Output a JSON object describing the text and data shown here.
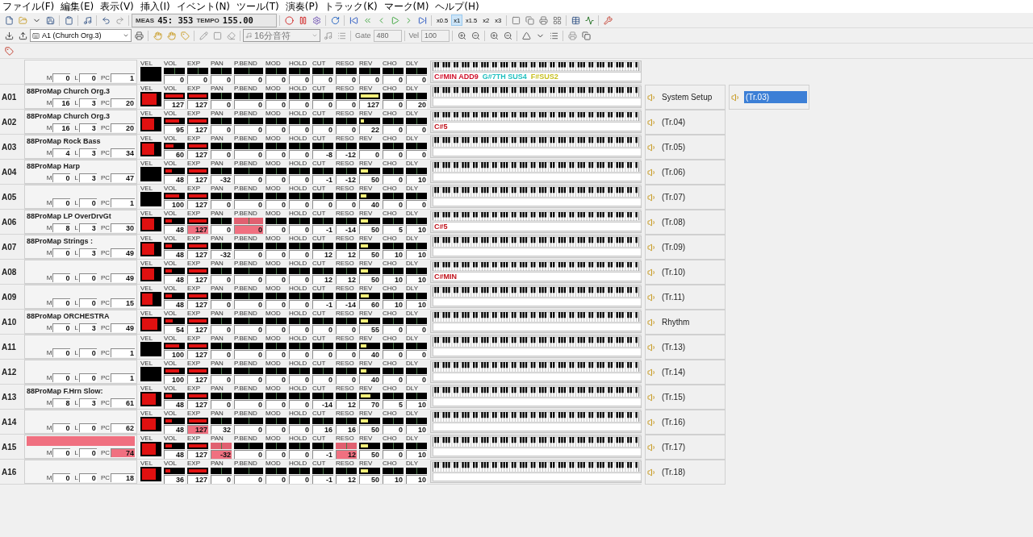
{
  "menu": [
    "ファイル(F)",
    "編集(E)",
    "表示(V)",
    "挿入(I)",
    "イベント(N)",
    "ツール(T)",
    "演奏(P)",
    "トラック(K)",
    "マーク(M)",
    "ヘルプ(H)"
  ],
  "transport": {
    "meas_label": "MEAS",
    "meas": "45: 353",
    "tempo_label": "TEMPO",
    "tempo": "155.00"
  },
  "speeds": [
    {
      "label": "x0.5",
      "selected": false
    },
    {
      "label": "x1",
      "selected": true
    },
    {
      "label": "x1.5",
      "selected": false
    },
    {
      "label": "x2",
      "selected": false
    },
    {
      "label": "x3",
      "selected": false
    }
  ],
  "port_select": {
    "value": "A1  (Church Org.3)"
  },
  "note_select": {
    "value": "16分音符",
    "disabled": true
  },
  "gate": {
    "label": "Gate",
    "value": "480",
    "disabled": true
  },
  "vel": {
    "label": "Vel",
    "value": "100",
    "disabled": true
  },
  "master": {
    "bank": [
      {
        "label": "M",
        "value": "0"
      },
      {
        "label": "L",
        "value": "0"
      },
      {
        "label": "PC",
        "value": "1"
      }
    ],
    "chord": [
      {
        "text": "C#MIN ADD9",
        "color": "#d0102a"
      },
      {
        "text": "G#7TH SUS4",
        "color": "#20c0c0"
      },
      {
        "text": "F#SUS2",
        "color": "#c8c020"
      }
    ],
    "controls": [
      {
        "kind": "vel",
        "label": "VEL"
      },
      {
        "kind": "bar",
        "label": "VOL",
        "value": "0"
      },
      {
        "kind": "bar",
        "label": "EXP",
        "value": "0"
      },
      {
        "kind": "bar",
        "label": "PAN",
        "value": "0"
      },
      {
        "kind": "bar",
        "label": "P.BEND",
        "value": "0"
      },
      {
        "kind": "bar",
        "label": "MOD",
        "value": "0"
      },
      {
        "kind": "bar",
        "label": "HOLD",
        "value": "0"
      },
      {
        "kind": "bar",
        "label": "CUT",
        "value": "0"
      },
      {
        "kind": "bar",
        "label": "RESO",
        "value": "0"
      },
      {
        "kind": "bar",
        "label": "REV",
        "value": "0"
      },
      {
        "kind": "bar",
        "label": "CHO",
        "value": "0"
      },
      {
        "kind": "bar",
        "label": "DLY",
        "value": "0"
      }
    ]
  },
  "channels": [
    {
      "port": "A01",
      "name": "88ProMap Church Org.3",
      "bank": [
        {
          "label": "M",
          "value": "16"
        },
        {
          "label": "L",
          "value": "3"
        },
        {
          "label": "PC",
          "value": "20"
        }
      ],
      "controls": [
        {
          "kind": "vel",
          "label": "VEL",
          "level": 0.8
        },
        {
          "kind": "fill",
          "label": "VOL",
          "value": "127",
          "level": 1
        },
        {
          "kind": "fill",
          "label": "EXP",
          "value": "127",
          "level": 1
        },
        {
          "kind": "bar",
          "label": "PAN",
          "value": "0"
        },
        {
          "kind": "bar",
          "label": "P.BEND",
          "value": "0"
        },
        {
          "kind": "bar",
          "label": "MOD",
          "value": "0"
        },
        {
          "kind": "bar",
          "label": "HOLD",
          "value": "0"
        },
        {
          "kind": "bar",
          "label": "CUT",
          "value": "0"
        },
        {
          "kind": "bar",
          "label": "RESO",
          "value": "0"
        },
        {
          "kind": "send",
          "label": "REV",
          "value": "127",
          "level": 1
        },
        {
          "kind": "bar",
          "label": "CHO",
          "value": "0"
        },
        {
          "kind": "bar",
          "label": "DLY",
          "value": "20"
        }
      ]
    },
    {
      "port": "A02",
      "name": "88ProMap Church Org.3",
      "bank": [
        {
          "label": "M",
          "value": "16"
        },
        {
          "label": "L",
          "value": "3"
        },
        {
          "label": "PC",
          "value": "20"
        }
      ],
      "chord": [
        {
          "text": "C#5",
          "color": "#c0101a"
        }
      ],
      "controls": [
        {
          "kind": "vel",
          "label": "VEL",
          "level": 0.7
        },
        {
          "kind": "fill",
          "label": "VOL",
          "value": "95",
          "level": 0.75
        },
        {
          "kind": "fill",
          "label": "EXP",
          "value": "127",
          "level": 1
        },
        {
          "kind": "bar",
          "label": "PAN",
          "value": "0"
        },
        {
          "kind": "bar",
          "label": "P.BEND",
          "value": "0"
        },
        {
          "kind": "bar",
          "label": "MOD",
          "value": "0"
        },
        {
          "kind": "bar",
          "label": "HOLD",
          "value": "0"
        },
        {
          "kind": "bar",
          "label": "CUT",
          "value": "0"
        },
        {
          "kind": "bar",
          "label": "RESO",
          "value": "0"
        },
        {
          "kind": "send",
          "label": "REV",
          "value": "22",
          "level": 0.17
        },
        {
          "kind": "bar",
          "label": "CHO",
          "value": "0"
        },
        {
          "kind": "bar",
          "label": "DLY",
          "value": "0"
        }
      ]
    },
    {
      "port": "A03",
      "name": "88ProMap Rock Bass",
      "bank": [
        {
          "label": "M",
          "value": "4"
        },
        {
          "label": "L",
          "value": "3"
        },
        {
          "label": "PC",
          "value": "34"
        }
      ],
      "controls": [
        {
          "kind": "vel",
          "label": "VEL",
          "level": 0.7
        },
        {
          "kind": "fill",
          "label": "VOL",
          "value": "60",
          "level": 0.47
        },
        {
          "kind": "fill",
          "label": "EXP",
          "value": "127",
          "level": 1
        },
        {
          "kind": "bar",
          "label": "PAN",
          "value": "0"
        },
        {
          "kind": "bar",
          "label": "P.BEND",
          "value": "0"
        },
        {
          "kind": "bar",
          "label": "MOD",
          "value": "0"
        },
        {
          "kind": "bar",
          "label": "HOLD",
          "value": "0"
        },
        {
          "kind": "bar",
          "label": "CUT",
          "value": "-8"
        },
        {
          "kind": "bar",
          "label": "RESO",
          "value": "-12"
        },
        {
          "kind": "send",
          "label": "REV",
          "value": "0"
        },
        {
          "kind": "bar",
          "label": "CHO",
          "value": "0"
        },
        {
          "kind": "bar",
          "label": "DLY",
          "value": "0"
        }
      ]
    },
    {
      "port": "A04",
      "name": "88ProMap Harp",
      "bank": [
        {
          "label": "M",
          "value": "0"
        },
        {
          "label": "L",
          "value": "3"
        },
        {
          "label": "PC",
          "value": "47"
        }
      ],
      "controls": [
        {
          "kind": "vel",
          "label": "VEL"
        },
        {
          "kind": "fill",
          "label": "VOL",
          "value": "48",
          "level": 0.38
        },
        {
          "kind": "fill",
          "label": "EXP",
          "value": "127",
          "level": 1
        },
        {
          "kind": "bar",
          "label": "PAN",
          "value": "-32"
        },
        {
          "kind": "bar",
          "label": "P.BEND",
          "value": "0"
        },
        {
          "kind": "bar",
          "label": "MOD",
          "value": "0"
        },
        {
          "kind": "bar",
          "label": "HOLD",
          "value": "0"
        },
        {
          "kind": "bar",
          "label": "CUT",
          "value": "-1"
        },
        {
          "kind": "bar",
          "label": "RESO",
          "value": "-12"
        },
        {
          "kind": "send",
          "label": "REV",
          "value": "50",
          "level": 0.39
        },
        {
          "kind": "bar",
          "label": "CHO",
          "value": "0"
        },
        {
          "kind": "bar",
          "label": "DLY",
          "value": "10"
        }
      ]
    },
    {
      "port": "A05",
      "bank": [
        {
          "label": "M",
          "value": "0"
        },
        {
          "label": "L",
          "value": "0"
        },
        {
          "label": "PC",
          "value": "1"
        }
      ],
      "controls": [
        {
          "kind": "vel",
          "label": "VEL"
        },
        {
          "kind": "fill",
          "label": "VOL",
          "value": "100",
          "level": 0.79
        },
        {
          "kind": "fill",
          "label": "EXP",
          "value": "127",
          "level": 1
        },
        {
          "kind": "bar",
          "label": "PAN",
          "value": "0"
        },
        {
          "kind": "bar",
          "label": "P.BEND",
          "value": "0"
        },
        {
          "kind": "bar",
          "label": "MOD",
          "value": "0"
        },
        {
          "kind": "bar",
          "label": "HOLD",
          "value": "0"
        },
        {
          "kind": "bar",
          "label": "CUT",
          "value": "0"
        },
        {
          "kind": "bar",
          "label": "RESO",
          "value": "0"
        },
        {
          "kind": "send",
          "label": "REV",
          "value": "40",
          "level": 0.31
        },
        {
          "kind": "bar",
          "label": "CHO",
          "value": "0"
        },
        {
          "kind": "bar",
          "label": "DLY",
          "value": "0"
        }
      ]
    },
    {
      "port": "A06",
      "name": "88ProMap LP OverDrvGt",
      "bank": [
        {
          "label": "M",
          "value": "8"
        },
        {
          "label": "L",
          "value": "3"
        },
        {
          "label": "PC",
          "value": "30"
        }
      ],
      "chord": [
        {
          "text": "C#5",
          "color": "#c0101a"
        }
      ],
      "controls": [
        {
          "kind": "vel",
          "label": "VEL",
          "level": 0.7
        },
        {
          "kind": "fill",
          "label": "VOL",
          "value": "48",
          "level": 0.38
        },
        {
          "kind": "fill",
          "label": "EXP",
          "value": "127",
          "level": 1,
          "highlighted": true
        },
        {
          "kind": "bar",
          "label": "PAN",
          "value": "0"
        },
        {
          "kind": "bar",
          "label": "P.BEND",
          "value": "0",
          "highlighted": true
        },
        {
          "kind": "bar",
          "label": "MOD",
          "value": "0"
        },
        {
          "kind": "bar",
          "label": "HOLD",
          "value": "0"
        },
        {
          "kind": "bar",
          "label": "CUT",
          "value": "-1"
        },
        {
          "kind": "bar",
          "label": "RESO",
          "value": "-14"
        },
        {
          "kind": "send",
          "label": "REV",
          "value": "50",
          "level": 0.39
        },
        {
          "kind": "bar",
          "label": "CHO",
          "value": "5"
        },
        {
          "kind": "bar",
          "label": "DLY",
          "value": "10"
        }
      ]
    },
    {
      "port": "A07",
      "name": "88ProMap Strings  :",
      "bank": [
        {
          "label": "M",
          "value": "0"
        },
        {
          "label": "L",
          "value": "3"
        },
        {
          "label": "PC",
          "value": "49"
        }
      ],
      "controls": [
        {
          "kind": "vel",
          "label": "VEL",
          "level": 0.7
        },
        {
          "kind": "fill",
          "label": "VOL",
          "value": "48",
          "level": 0.38
        },
        {
          "kind": "fill",
          "label": "EXP",
          "value": "127",
          "level": 1
        },
        {
          "kind": "bar",
          "label": "PAN",
          "value": "-32"
        },
        {
          "kind": "bar",
          "label": "P.BEND",
          "value": "0"
        },
        {
          "kind": "bar",
          "label": "MOD",
          "value": "0"
        },
        {
          "kind": "bar",
          "label": "HOLD",
          "value": "0"
        },
        {
          "kind": "bar",
          "label": "CUT",
          "value": "12"
        },
        {
          "kind": "bar",
          "label": "RESO",
          "value": "12"
        },
        {
          "kind": "send",
          "label": "REV",
          "value": "50",
          "level": 0.39
        },
        {
          "kind": "bar",
          "label": "CHO",
          "value": "10"
        },
        {
          "kind": "bar",
          "label": "DLY",
          "value": "10"
        }
      ]
    },
    {
      "port": "A08",
      "bank": [
        {
          "label": "M",
          "value": "0"
        },
        {
          "label": "L",
          "value": "0"
        },
        {
          "label": "PC",
          "value": "49"
        }
      ],
      "chord": [
        {
          "text": "C#MIN",
          "color": "#c0101a"
        }
      ],
      "controls": [
        {
          "kind": "vel",
          "label": "VEL",
          "level": 0.7
        },
        {
          "kind": "fill",
          "label": "VOL",
          "value": "48",
          "level": 0.38
        },
        {
          "kind": "fill",
          "label": "EXP",
          "value": "127",
          "level": 1
        },
        {
          "kind": "bar",
          "label": "PAN",
          "value": "0"
        },
        {
          "kind": "bar",
          "label": "P.BEND",
          "value": "0"
        },
        {
          "kind": "bar",
          "label": "MOD",
          "value": "0"
        },
        {
          "kind": "bar",
          "label": "HOLD",
          "value": "0"
        },
        {
          "kind": "bar",
          "label": "CUT",
          "value": "12"
        },
        {
          "kind": "bar",
          "label": "RESO",
          "value": "12"
        },
        {
          "kind": "send",
          "label": "REV",
          "value": "50",
          "level": 0.39
        },
        {
          "kind": "bar",
          "label": "CHO",
          "value": "10"
        },
        {
          "kind": "bar",
          "label": "DLY",
          "value": "10"
        }
      ]
    },
    {
      "port": "A09",
      "bank": [
        {
          "label": "M",
          "value": "0"
        },
        {
          "label": "L",
          "value": "0"
        },
        {
          "label": "PC",
          "value": "15"
        }
      ],
      "controls": [
        {
          "kind": "vel",
          "label": "VEL",
          "level": 0.6
        },
        {
          "kind": "fill",
          "label": "VOL",
          "value": "48",
          "level": 0.38
        },
        {
          "kind": "fill",
          "label": "EXP",
          "value": "127",
          "level": 1
        },
        {
          "kind": "bar",
          "label": "PAN",
          "value": "0"
        },
        {
          "kind": "bar",
          "label": "P.BEND",
          "value": "0"
        },
        {
          "kind": "bar",
          "label": "MOD",
          "value": "0"
        },
        {
          "kind": "bar",
          "label": "HOLD",
          "value": "0"
        },
        {
          "kind": "bar",
          "label": "CUT",
          "value": "-1"
        },
        {
          "kind": "bar",
          "label": "RESO",
          "value": "-14"
        },
        {
          "kind": "send",
          "label": "REV",
          "value": "60",
          "level": 0.47
        },
        {
          "kind": "bar",
          "label": "CHO",
          "value": "10"
        },
        {
          "kind": "bar",
          "label": "DLY",
          "value": "10"
        }
      ]
    },
    {
      "port": "A10",
      "name": "88ProMap ORCHESTRA",
      "bank": [
        {
          "label": "M",
          "value": "0"
        },
        {
          "label": "L",
          "value": "3"
        },
        {
          "label": "PC",
          "value": "49"
        }
      ],
      "controls": [
        {
          "kind": "vel",
          "label": "VEL",
          "level": 0.85
        },
        {
          "kind": "fill",
          "label": "VOL",
          "value": "54",
          "level": 0.43
        },
        {
          "kind": "fill",
          "label": "EXP",
          "value": "127",
          "level": 1
        },
        {
          "kind": "bar",
          "label": "PAN",
          "value": "0"
        },
        {
          "kind": "bar",
          "label": "P.BEND",
          "value": "0"
        },
        {
          "kind": "bar",
          "label": "MOD",
          "value": "0"
        },
        {
          "kind": "bar",
          "label": "HOLD",
          "value": "0"
        },
        {
          "kind": "bar",
          "label": "CUT",
          "value": "0"
        },
        {
          "kind": "bar",
          "label": "RESO",
          "value": "0"
        },
        {
          "kind": "send",
          "label": "REV",
          "value": "55",
          "level": 0.43
        },
        {
          "kind": "bar",
          "label": "CHO",
          "value": "0"
        },
        {
          "kind": "bar",
          "label": "DLY",
          "value": "0"
        }
      ]
    },
    {
      "port": "A11",
      "bank": [
        {
          "label": "M",
          "value": "0"
        },
        {
          "label": "L",
          "value": "0"
        },
        {
          "label": "PC",
          "value": "1"
        }
      ],
      "controls": [
        {
          "kind": "vel",
          "label": "VEL"
        },
        {
          "kind": "fill",
          "label": "VOL",
          "value": "100",
          "level": 0.79
        },
        {
          "kind": "fill",
          "label": "EXP",
          "value": "127",
          "level": 1
        },
        {
          "kind": "bar",
          "label": "PAN",
          "value": "0"
        },
        {
          "kind": "bar",
          "label": "P.BEND",
          "value": "0"
        },
        {
          "kind": "bar",
          "label": "MOD",
          "value": "0"
        },
        {
          "kind": "bar",
          "label": "HOLD",
          "value": "0"
        },
        {
          "kind": "bar",
          "label": "CUT",
          "value": "0"
        },
        {
          "kind": "bar",
          "label": "RESO",
          "value": "0"
        },
        {
          "kind": "send",
          "label": "REV",
          "value": "40",
          "level": 0.31
        },
        {
          "kind": "bar",
          "label": "CHO",
          "value": "0"
        },
        {
          "kind": "bar",
          "label": "DLY",
          "value": "0"
        }
      ]
    },
    {
      "port": "A12",
      "bank": [
        {
          "label": "M",
          "value": "0"
        },
        {
          "label": "L",
          "value": "0"
        },
        {
          "label": "PC",
          "value": "1"
        }
      ],
      "controls": [
        {
          "kind": "vel",
          "label": "VEL"
        },
        {
          "kind": "fill",
          "label": "VOL",
          "value": "100",
          "level": 0.79
        },
        {
          "kind": "fill",
          "label": "EXP",
          "value": "127",
          "level": 1
        },
        {
          "kind": "bar",
          "label": "PAN",
          "value": "0"
        },
        {
          "kind": "bar",
          "label": "P.BEND",
          "value": "0"
        },
        {
          "kind": "bar",
          "label": "MOD",
          "value": "0"
        },
        {
          "kind": "bar",
          "label": "HOLD",
          "value": "0"
        },
        {
          "kind": "bar",
          "label": "CUT",
          "value": "0"
        },
        {
          "kind": "bar",
          "label": "RESO",
          "value": "0"
        },
        {
          "kind": "send",
          "label": "REV",
          "value": "40",
          "level": 0.31
        },
        {
          "kind": "bar",
          "label": "CHO",
          "value": "0"
        },
        {
          "kind": "bar",
          "label": "DLY",
          "value": "0"
        }
      ]
    },
    {
      "port": "A13",
      "name": "88ProMap F.Hrn Slow:",
      "bank": [
        {
          "label": "M",
          "value": "8"
        },
        {
          "label": "L",
          "value": "3"
        },
        {
          "label": "PC",
          "value": "61"
        }
      ],
      "controls": [
        {
          "kind": "vel",
          "label": "VEL",
          "level": 0.75
        },
        {
          "kind": "fill",
          "label": "VOL",
          "value": "48",
          "level": 0.38
        },
        {
          "kind": "fill",
          "label": "EXP",
          "value": "127",
          "level": 1
        },
        {
          "kind": "bar",
          "label": "PAN",
          "value": "0"
        },
        {
          "kind": "bar",
          "label": "P.BEND",
          "value": "0"
        },
        {
          "kind": "bar",
          "label": "MOD",
          "value": "0"
        },
        {
          "kind": "bar",
          "label": "HOLD",
          "value": "0"
        },
        {
          "kind": "bar",
          "label": "CUT",
          "value": "-14"
        },
        {
          "kind": "bar",
          "label": "RESO",
          "value": "12"
        },
        {
          "kind": "send",
          "label": "REV",
          "value": "70",
          "level": 0.55
        },
        {
          "kind": "bar",
          "label": "CHO",
          "value": "5"
        },
        {
          "kind": "bar",
          "label": "DLY",
          "value": "10"
        }
      ]
    },
    {
      "port": "A14",
      "bank": [
        {
          "label": "M",
          "value": "0"
        },
        {
          "label": "L",
          "value": "0"
        },
        {
          "label": "PC",
          "value": "62"
        }
      ],
      "controls": [
        {
          "kind": "vel",
          "label": "VEL",
          "level": 0.75
        },
        {
          "kind": "fill",
          "label": "VOL",
          "value": "48",
          "level": 0.38
        },
        {
          "kind": "fill",
          "label": "EXP",
          "value": "127",
          "level": 1,
          "highlighted": true
        },
        {
          "kind": "bar",
          "label": "PAN",
          "value": "32"
        },
        {
          "kind": "bar",
          "label": "P.BEND",
          "value": "0"
        },
        {
          "kind": "bar",
          "label": "MOD",
          "value": "0"
        },
        {
          "kind": "bar",
          "label": "HOLD",
          "value": "0"
        },
        {
          "kind": "bar",
          "label": "CUT",
          "value": "16"
        },
        {
          "kind": "bar",
          "label": "RESO",
          "value": "16"
        },
        {
          "kind": "send",
          "label": "REV",
          "value": "50",
          "level": 0.39
        },
        {
          "kind": "bar",
          "label": "CHO",
          "value": "0"
        },
        {
          "kind": "bar",
          "label": "DLY",
          "value": "10"
        }
      ]
    },
    {
      "port": "A15",
      "highlighted": true,
      "bank": [
        {
          "label": "M",
          "value": "0"
        },
        {
          "label": "L",
          "value": "0"
        },
        {
          "label": "PC",
          "value": "74",
          "highlighted": true
        }
      ],
      "controls": [
        {
          "kind": "vel",
          "label": "VEL",
          "level": 0.75
        },
        {
          "kind": "fill",
          "label": "VOL",
          "value": "48",
          "level": 0.38
        },
        {
          "kind": "fill",
          "label": "EXP",
          "value": "127",
          "level": 1
        },
        {
          "kind": "bar",
          "label": "PAN",
          "value": "-32",
          "highlighted": true
        },
        {
          "kind": "bar",
          "label": "P.BEND",
          "value": "0"
        },
        {
          "kind": "bar",
          "label": "MOD",
          "value": "0"
        },
        {
          "kind": "bar",
          "label": "HOLD",
          "value": "0"
        },
        {
          "kind": "bar",
          "label": "CUT",
          "value": "-1"
        },
        {
          "kind": "bar",
          "label": "RESO",
          "value": "12",
          "highlighted": true
        },
        {
          "kind": "send",
          "label": "REV",
          "value": "50",
          "level": 0.39
        },
        {
          "kind": "bar",
          "label": "CHO",
          "value": "0"
        },
        {
          "kind": "bar",
          "label": "DLY",
          "value": "10"
        }
      ]
    },
    {
      "port": "A16",
      "bank": [
        {
          "label": "M",
          "value": "0"
        },
        {
          "label": "L",
          "value": "0"
        },
        {
          "label": "PC",
          "value": "18"
        }
      ],
      "controls": [
        {
          "kind": "vel",
          "label": "VEL",
          "level": 0.75
        },
        {
          "kind": "fill",
          "label": "VOL",
          "value": "36",
          "level": 0.28
        },
        {
          "kind": "fill",
          "label": "EXP",
          "value": "127",
          "level": 1
        },
        {
          "kind": "bar",
          "label": "PAN",
          "value": "0"
        },
        {
          "kind": "bar",
          "label": "P.BEND",
          "value": "0"
        },
        {
          "kind": "bar",
          "label": "MOD",
          "value": "0"
        },
        {
          "kind": "bar",
          "label": "HOLD",
          "value": "0"
        },
        {
          "kind": "bar",
          "label": "CUT",
          "value": "-1"
        },
        {
          "kind": "bar",
          "label": "RESO",
          "value": "12"
        },
        {
          "kind": "send",
          "label": "REV",
          "value": "50",
          "level": 0.39
        },
        {
          "kind": "bar",
          "label": "CHO",
          "value": "10"
        },
        {
          "kind": "bar",
          "label": "DLY",
          "value": "10"
        }
      ]
    }
  ],
  "tracks": [
    {
      "label": "System Setup",
      "selected": false
    },
    {
      "label": "(Tr.04)",
      "selected": false
    },
    {
      "label": "(Tr.05)",
      "selected": false
    },
    {
      "label": "(Tr.06)",
      "selected": false
    },
    {
      "label": "(Tr.07)",
      "selected": false
    },
    {
      "label": "(Tr.08)",
      "selected": false
    },
    {
      "label": "(Tr.09)",
      "selected": false
    },
    {
      "label": "(Tr.10)",
      "selected": false
    },
    {
      "label": "(Tr.11)",
      "selected": false
    },
    {
      "label": "Rhythm",
      "selected": false
    },
    {
      "label": "(Tr.13)",
      "selected": false
    },
    {
      "label": "(Tr.14)",
      "selected": false
    },
    {
      "label": "(Tr.15)",
      "selected": false
    },
    {
      "label": "(Tr.16)",
      "selected": false
    },
    {
      "label": "(Tr.17)",
      "selected": false
    },
    {
      "label": "(Tr.18)",
      "selected": false
    }
  ],
  "tracks_2": [
    {
      "label": "(Tr.03)",
      "selected": true
    }
  ]
}
